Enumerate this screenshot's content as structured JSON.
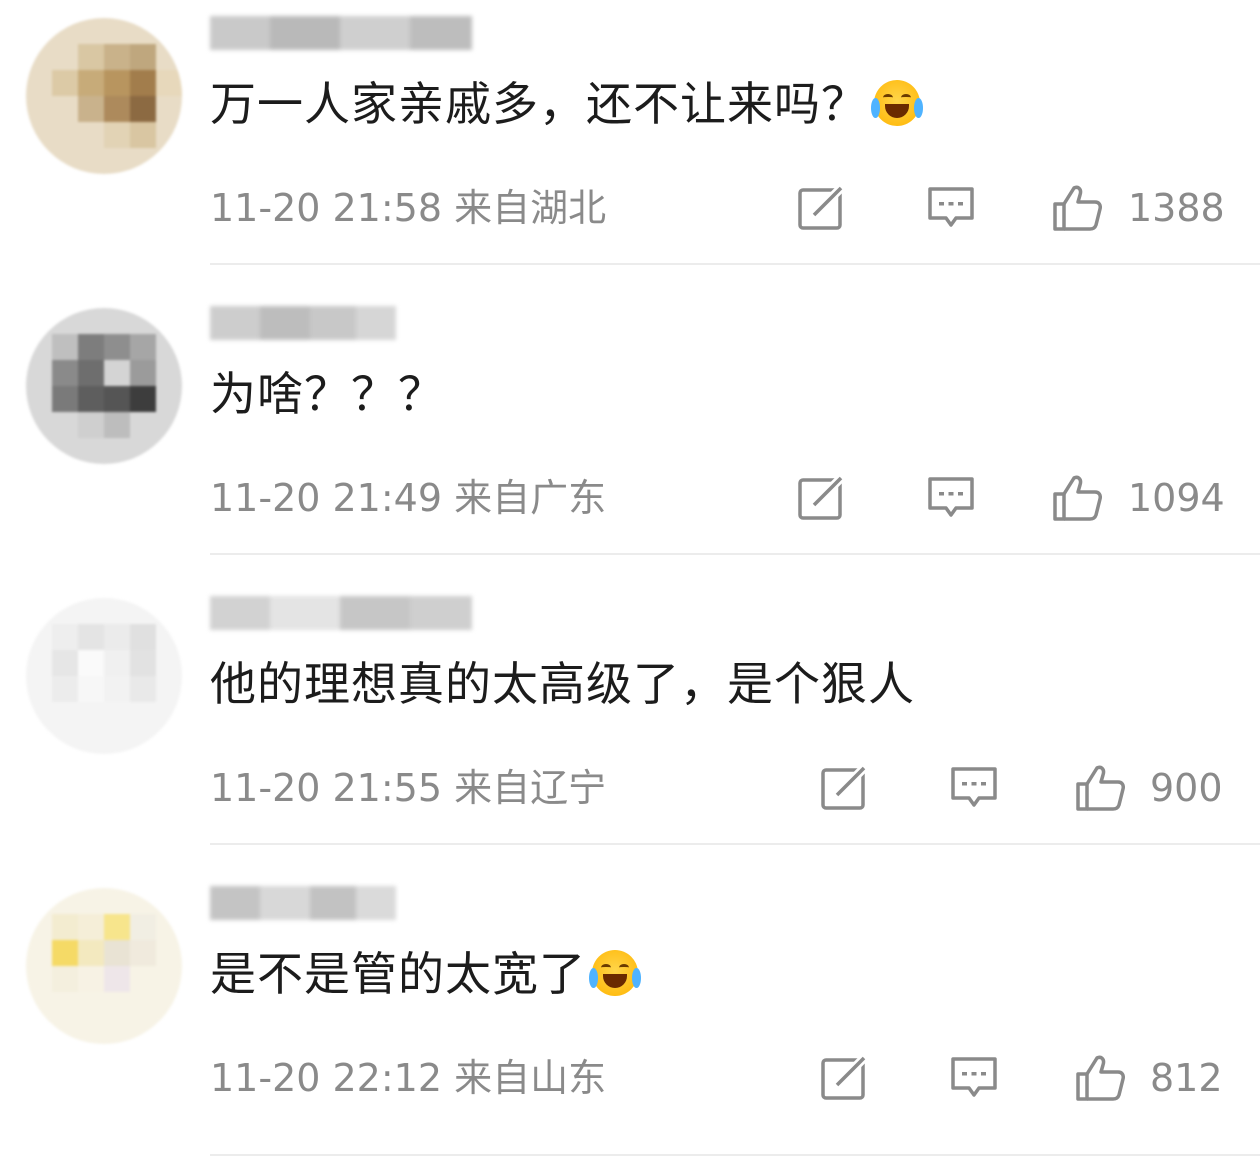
{
  "comments": [
    {
      "text": "万一人家亲戚多，还不让来吗？",
      "emoji": "crying-laughing-emoji",
      "time": "11-20 21:58",
      "location": "来自湖北",
      "likes": "1388",
      "icons": {
        "share": "share-icon",
        "reply": "comment-icon",
        "like": "thumbs-up-icon"
      }
    },
    {
      "text": "为啥？？？",
      "emoji": "",
      "time": "11-20 21:49",
      "location": "来自广东",
      "likes": "1094",
      "icons": {
        "share": "share-icon",
        "reply": "comment-icon",
        "like": "thumbs-up-icon"
      }
    },
    {
      "text": "他的理想真的太高级了，是个狠人",
      "emoji": "",
      "time": "11-20 21:55",
      "location": "来自辽宁",
      "likes": "900",
      "icons": {
        "share": "share-icon",
        "reply": "comment-icon",
        "like": "thumbs-up-icon"
      }
    },
    {
      "text": "是不是管的太宽了",
      "emoji": "laughing-emoji",
      "time": "11-20 22:12",
      "location": "来自山东",
      "likes": "812",
      "icons": {
        "share": "share-icon",
        "reply": "comment-icon",
        "like": "thumbs-up-icon"
      }
    }
  ],
  "colors": {
    "text": "#1c1c1c",
    "meta": "#8a8a8a",
    "divider": "#ececec"
  }
}
